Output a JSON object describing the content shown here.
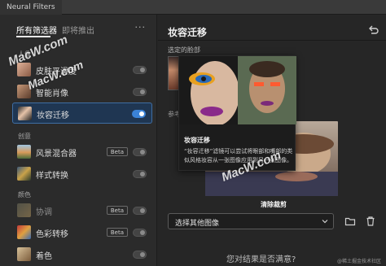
{
  "window": {
    "title": "Neural Filters"
  },
  "left_panel": {
    "tabs": [
      {
        "label": "所有筛选器",
        "active": true
      },
      {
        "label": "即将推出",
        "active": false
      }
    ],
    "more_label": "···",
    "categories": {
      "portrait": "人像",
      "creative": "创意",
      "color": "颜色"
    },
    "filters": [
      {
        "label": "皮肤平滑度",
        "enabled": false
      },
      {
        "label": "智能肖像",
        "enabled": false
      },
      {
        "label": "妆容迁移",
        "enabled": true,
        "selected": true
      },
      {
        "label": "风景混合器",
        "badge": "Beta",
        "enabled": false
      },
      {
        "label": "样式转换",
        "enabled": false
      },
      {
        "label": "协调",
        "badge": "Beta",
        "enabled": false,
        "dimmed": true
      },
      {
        "label": "色彩转移",
        "badge": "Beta",
        "enabled": false
      },
      {
        "label": "着色",
        "enabled": false
      }
    ]
  },
  "right_panel": {
    "title": "妆容迁移",
    "selected_face_label": "选定的脸部",
    "reference_label": "参考",
    "clear_crop_label": "清除裁剪",
    "select": {
      "value": "选择其他图像"
    },
    "satisfied_prompt": "您对结果是否满意?",
    "source_note": "@稀土掘金技术社区"
  },
  "tooltip": {
    "title": "妆容迁移",
    "body": "“妆容迁移”滤镜可以尝试将眼部和嘴部的类似风格妆容从一张图像应用到另一张图像。"
  },
  "watermarks": [
    "MacW.com",
    "MacW.com",
    "MacW.com"
  ],
  "colors": {
    "accent": "#3b82d6",
    "selected_bg": "#1f3652"
  }
}
